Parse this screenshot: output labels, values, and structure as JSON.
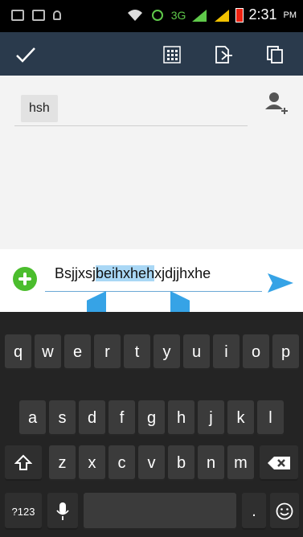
{
  "status_bar": {
    "network": "3G",
    "time": "2:31",
    "ampm": "PM"
  },
  "recipient": {
    "chip_label": "hsh"
  },
  "compose": {
    "text_before": "Bsjjxsj",
    "text_selected": "beihxheh",
    "text_after": "xjdjjhxhe"
  },
  "keyboard": {
    "row1": [
      "q",
      "w",
      "e",
      "r",
      "t",
      "y",
      "u",
      "i",
      "o",
      "p"
    ],
    "row2": [
      "a",
      "s",
      "d",
      "f",
      "g",
      "h",
      "j",
      "k",
      "l"
    ],
    "row3": [
      "z",
      "x",
      "c",
      "v",
      "b",
      "n",
      "m"
    ],
    "row4": {
      "symbols_key": "?123",
      "period_key": "."
    }
  },
  "colors": {
    "action_bar": "#2a3a4c",
    "add_button": "#4bbd2d",
    "accent": "#36a3e6",
    "keyboard_bg": "#242424"
  },
  "icons": {
    "action_bar": [
      "check-icon",
      "grid-icon",
      "export-icon",
      "copy-icon"
    ],
    "recipient": [
      "add-contact-icon"
    ],
    "compose": [
      "add-attachment-icon",
      "send-icon"
    ],
    "keyboard": [
      "shift-icon",
      "backspace-icon",
      "microphone-icon",
      "emoji-icon"
    ]
  }
}
